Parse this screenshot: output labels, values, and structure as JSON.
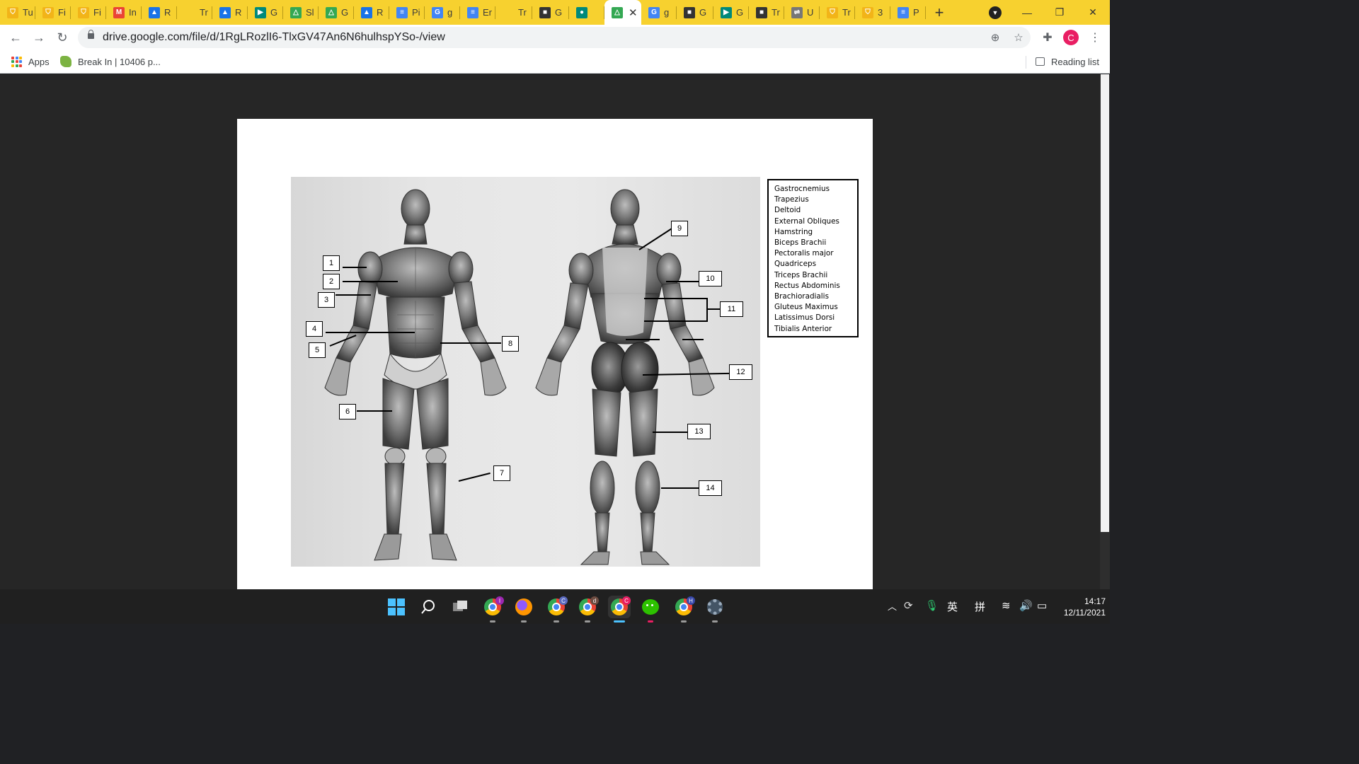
{
  "browser": {
    "tabs": [
      {
        "title": "Tu",
        "icon": "school-shield-icon",
        "color": "#f2b418"
      },
      {
        "title": "Fi",
        "icon": "school-shield-icon",
        "color": "#f2b418"
      },
      {
        "title": "Fi",
        "icon": "school-shield-icon",
        "color": "#f2b418"
      },
      {
        "title": "In",
        "icon": "gmail-icon",
        "color": "#ea4335"
      },
      {
        "title": "R",
        "icon": "classroom-icon",
        "color": "#1a73e8"
      },
      {
        "title": "Tr",
        "icon": "blank-icon",
        "color": "#f7d12f"
      },
      {
        "title": "R",
        "icon": "classroom-icon",
        "color": "#1a73e8"
      },
      {
        "title": "G",
        "icon": "meet-icon",
        "color": "#00897b"
      },
      {
        "title": "Sl",
        "icon": "drive-icon",
        "color": "#34a853"
      },
      {
        "title": "G",
        "icon": "drive-icon",
        "color": "#34a853"
      },
      {
        "title": "R",
        "icon": "classroom-icon",
        "color": "#1a73e8"
      },
      {
        "title": "Pi",
        "icon": "docs-icon",
        "color": "#4285f4"
      },
      {
        "title": "g",
        "icon": "google-icon",
        "color": "#4285f4"
      },
      {
        "title": "Er",
        "icon": "docs-icon",
        "color": "#4285f4"
      },
      {
        "title": "Tr",
        "icon": "blank-icon",
        "color": "#f7d12f"
      },
      {
        "title": "G",
        "icon": "classroom-dark-icon",
        "color": "#333333"
      },
      {
        "title": "",
        "icon": "meet-recording-icon",
        "color": "#00897b"
      },
      {
        "title": "",
        "icon": "drive-icon",
        "color": "#34a853",
        "active": true
      },
      {
        "title": "g",
        "icon": "google-icon",
        "color": "#4285f4"
      },
      {
        "title": "G",
        "icon": "classroom-dark-icon",
        "color": "#333333"
      },
      {
        "title": "G",
        "icon": "meet-icon",
        "color": "#00897b"
      },
      {
        "title": "Tr",
        "icon": "classroom-dark-icon",
        "color": "#333333"
      },
      {
        "title": "U",
        "icon": "link-icon",
        "color": "#777777"
      },
      {
        "title": "Tr",
        "icon": "school-shield-icon",
        "color": "#f2b418"
      },
      {
        "title": "3",
        "icon": "school-shield-icon",
        "color": "#f2b418"
      },
      {
        "title": "P",
        "icon": "docs-icon",
        "color": "#4285f4"
      }
    ],
    "url": "drive.google.com/file/d/1RgLRozlI6-TlxGV47An6N6hulhspYSo-/view",
    "profile_initial": "C",
    "bookmarks": {
      "apps": "Apps",
      "item1": "Break In | 10406 p...",
      "reading_list": "Reading list"
    }
  },
  "worksheet": {
    "word_bank": [
      "Gastrocnemius",
      "Trapezius",
      "Deltoid",
      "External Obliques",
      "Hamstring",
      "Biceps Brachii",
      "Pectoralis major",
      "Quadriceps",
      "Triceps Brachii",
      "Rectus Abdominis",
      "Brachioradialis",
      "Gluteus Maximus",
      "Latissimus Dorsi",
      "Tibialis Anterior"
    ],
    "labels": [
      "1",
      "2",
      "3",
      "4",
      "5",
      "6",
      "7",
      "8",
      "9",
      "10",
      "11",
      "12",
      "13",
      "14"
    ]
  },
  "taskbar": {
    "tray_lang1": "英",
    "tray_lang2": "拼",
    "time": "14:17",
    "date": "12/11/2021",
    "badges": {
      "chrome1": "I",
      "chrome2": "C",
      "chrome3": "d",
      "chrome4": "C",
      "chrome5": "H"
    }
  }
}
